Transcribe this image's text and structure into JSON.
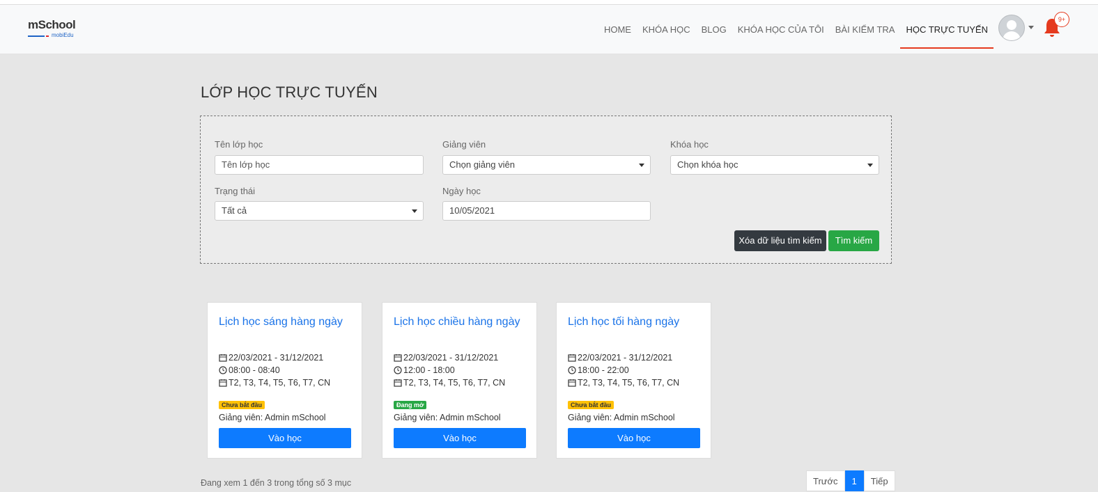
{
  "brand": {
    "logo_main": "mSchool",
    "logo_sub": "mobiEdu"
  },
  "nav": {
    "items": [
      "HOME",
      "KHÓA HỌC",
      "BLOG",
      "KHÓA HỌC CỦA TÔI",
      "BÀI KIỂM TRA",
      "HỌC TRỰC TUYẾN"
    ],
    "active": "HỌC TRỰC TUYẾN",
    "notification_badge": "9+"
  },
  "page": {
    "title": "LỚP HỌC TRỰC TUYẾN"
  },
  "filters": {
    "class_name": {
      "label": "Tên lớp học",
      "placeholder": "Tên lớp học"
    },
    "teacher": {
      "label": "Giảng viên",
      "value": "Chọn giảng viên"
    },
    "course": {
      "label": "Khóa học",
      "value": "Chọn khóa học"
    },
    "status": {
      "label": "Trạng thái",
      "value": "Tất cả"
    },
    "date": {
      "label": "Ngày học",
      "value": "10/05/2021"
    },
    "clear_label": "Xóa dữ liệu tìm kiếm",
    "search_label": "Tìm kiếm"
  },
  "cards": [
    {
      "title": "Lịch học sáng hàng ngày",
      "dates": "22/03/2021 - 31/12/2021",
      "time": "08:00 - 08:40",
      "days": "T2, T3, T4, T5, T6, T7, CN",
      "status": "Chưa bắt đầu",
      "status_color": "#ffc107",
      "teacher": "Giảng viên: Admin mSchool",
      "button": "Vào học"
    },
    {
      "title": "Lịch học chiều hàng ngày",
      "dates": "22/03/2021 - 31/12/2021",
      "time": "12:00 - 18:00",
      "days": "T2, T3, T4, T5, T6, T7, CN",
      "status": "Đang mở",
      "status_color": "#28a745",
      "teacher": "Giảng viên: Admin mSchool",
      "button": "Vào học"
    },
    {
      "title": "Lịch học tối hàng ngày",
      "dates": "22/03/2021 - 31/12/2021",
      "time": "18:00 - 22:00",
      "days": "T2, T3, T4, T5, T6, T7, CN",
      "status": "Chưa bắt đầu",
      "status_color": "#ffc107",
      "teacher": "Giảng viên: Admin mSchool",
      "button": "Vào học"
    }
  ],
  "footer": {
    "info": "Đang xem 1 đến 3 trong tổng số 3 mục",
    "prev": "Trước",
    "current_page": "1",
    "next": "Tiếp"
  },
  "colors": {
    "accent": "#0d7bff",
    "active_underline": "#e53a1e",
    "title_blue": "#1a73e8",
    "success": "#28a745",
    "warning": "#ffc107",
    "dark": "#343a40"
  }
}
